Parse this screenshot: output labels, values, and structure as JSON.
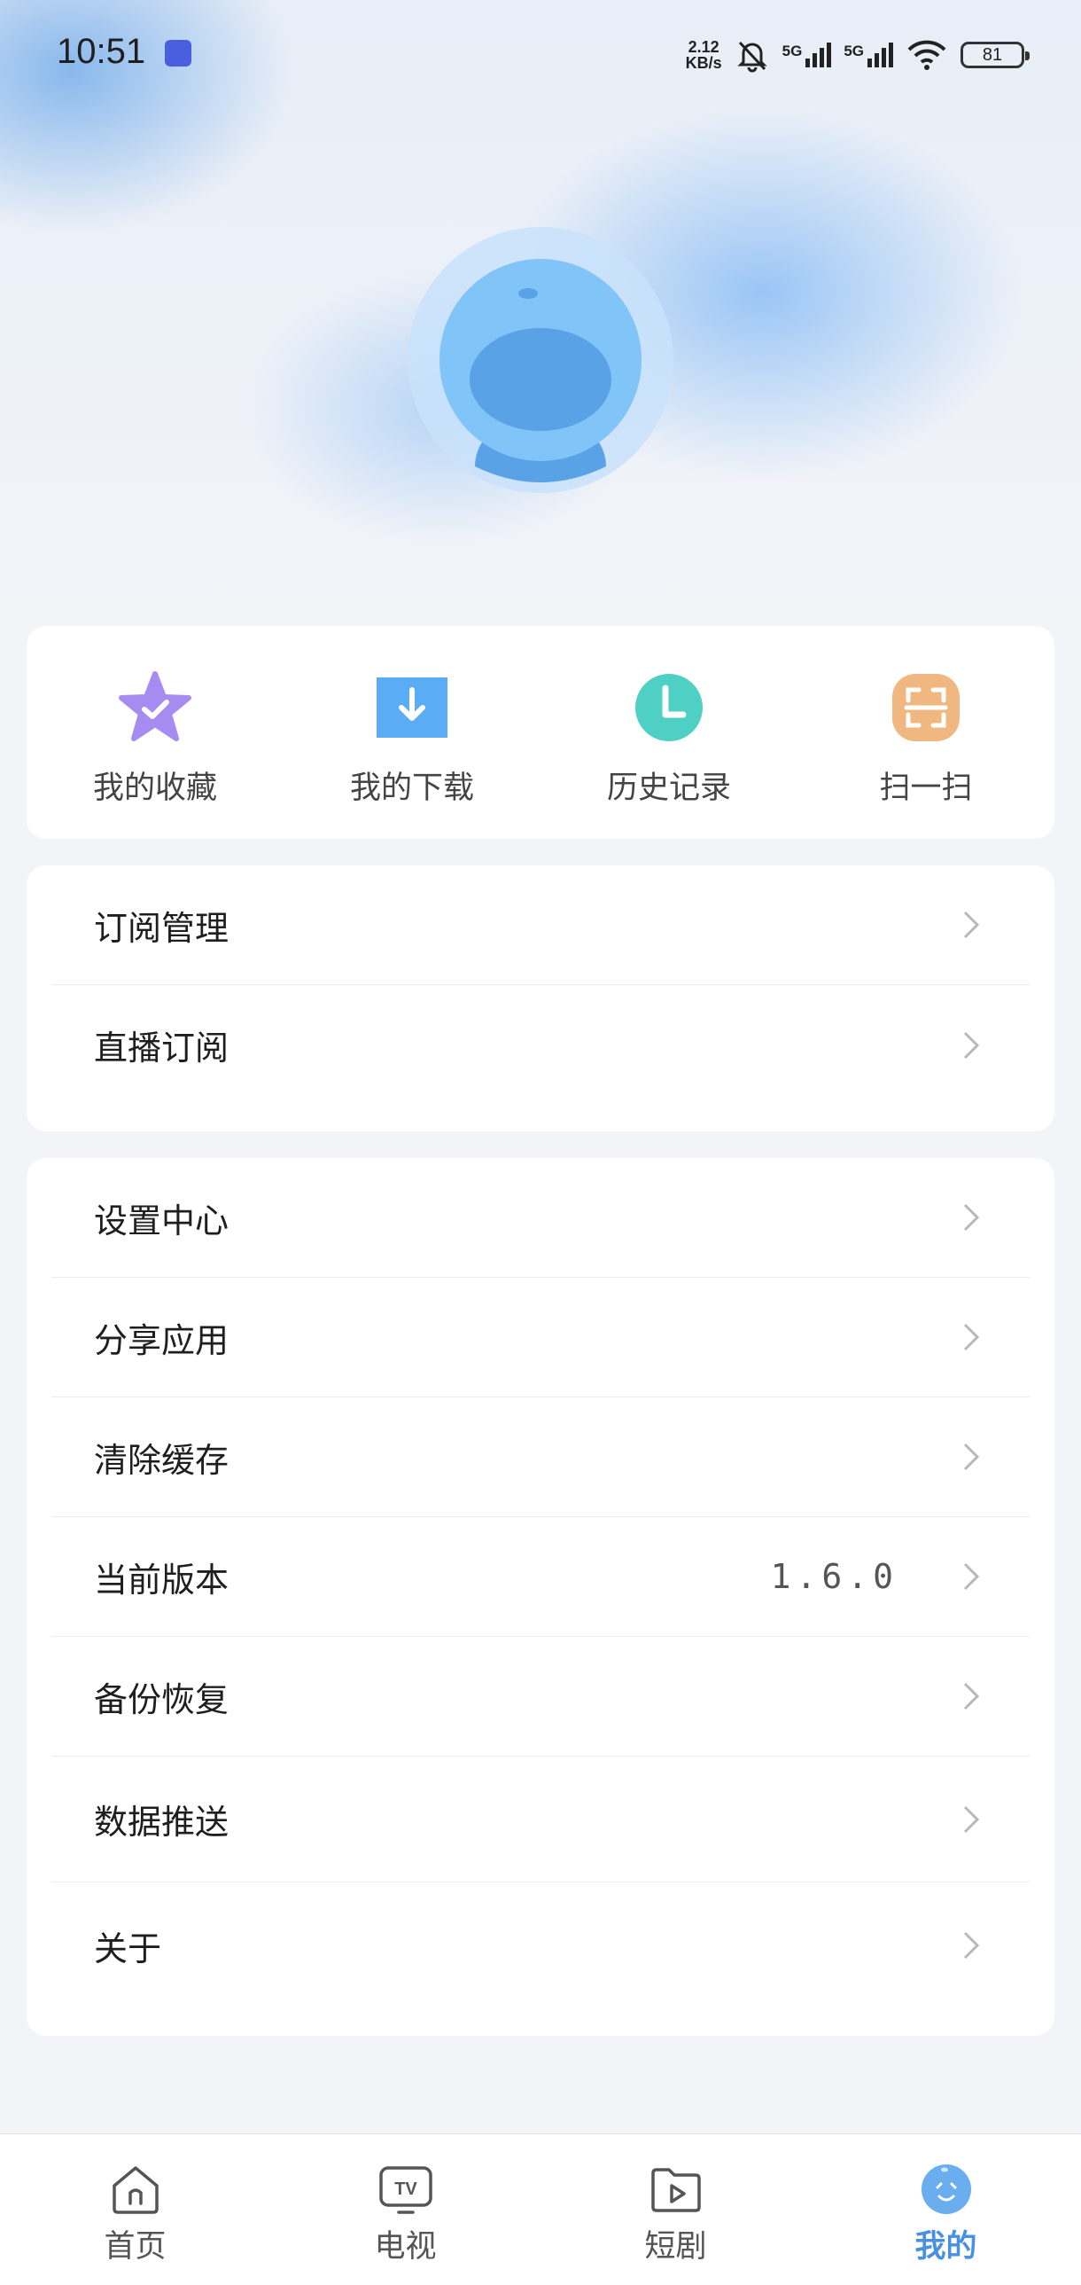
{
  "status_bar": {
    "time": "10:51",
    "net_speed_value": "2.12",
    "net_speed_unit": "KB/s",
    "sim1_label": "5G",
    "sim2_label": "5G",
    "battery": "81"
  },
  "quick_actions": [
    {
      "label": "我的收藏",
      "icon": "star-check-icon",
      "color": "#a68cf0"
    },
    {
      "label": "我的下载",
      "icon": "download-icon",
      "color": "#5aacf5"
    },
    {
      "label": "历史记录",
      "icon": "clock-icon",
      "color": "#4fd0c4"
    },
    {
      "label": "扫一扫",
      "icon": "scan-icon",
      "color": "#f0b880"
    }
  ],
  "subscriptions": [
    {
      "label": "订阅管理"
    },
    {
      "label": "直播订阅"
    }
  ],
  "settings": [
    {
      "label": "设置中心"
    },
    {
      "label": "分享应用"
    },
    {
      "label": "清除缓存"
    },
    {
      "label": "当前版本",
      "value": "1.6.0"
    },
    {
      "label": "备份恢复"
    },
    {
      "label": "数据推送"
    },
    {
      "label": "关于"
    }
  ],
  "bottom_nav": [
    {
      "label": "首页",
      "icon": "home-icon"
    },
    {
      "label": "电视",
      "icon": "tv-icon"
    },
    {
      "label": "短剧",
      "icon": "play-folder-icon"
    },
    {
      "label": "我的",
      "icon": "profile-face-icon",
      "active": true
    }
  ],
  "colors": {
    "accent": "#4a90e2",
    "avatar_light": "#80c4f8",
    "avatar_dark": "#5aa2e6"
  }
}
